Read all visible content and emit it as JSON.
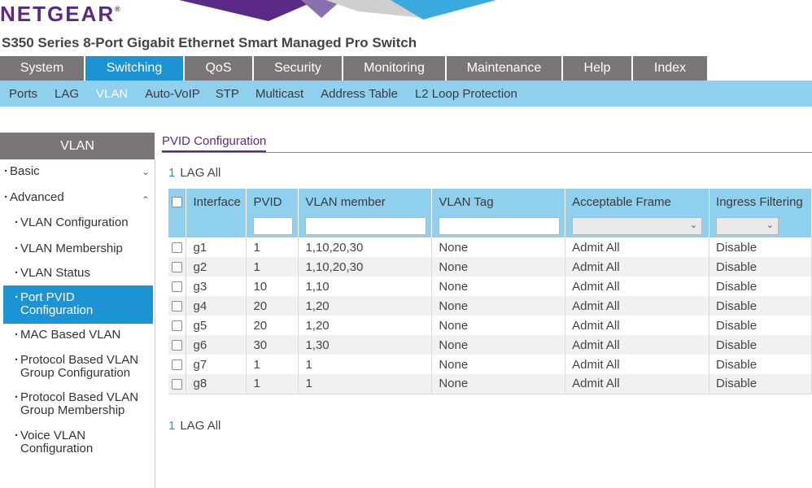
{
  "brand": {
    "logo": "NETGEAR",
    "mark": "®"
  },
  "product_title": "S350 Series 8-Port Gigabit Ethernet Smart Managed Pro Switch",
  "colors": {
    "accent": "#1c93d3",
    "brand": "#5b2a86",
    "nav_bg": "#7a7576",
    "subnav_bg": "#8fd0ee"
  },
  "main_nav": [
    {
      "label": "System"
    },
    {
      "label": "Switching"
    },
    {
      "label": "QoS"
    },
    {
      "label": "Security"
    },
    {
      "label": "Monitoring"
    },
    {
      "label": "Maintenance"
    },
    {
      "label": "Help"
    },
    {
      "label": "Index"
    }
  ],
  "sub_nav": [
    {
      "label": "Ports"
    },
    {
      "label": "LAG"
    },
    {
      "label": "VLAN"
    },
    {
      "label": "Auto-VoIP"
    },
    {
      "label": "STP"
    },
    {
      "label": "Multicast"
    },
    {
      "label": "Address Table"
    },
    {
      "label": "L2 Loop Protection"
    }
  ],
  "sidebar": {
    "title": "VLAN",
    "basic": "Basic",
    "advanced": "Advanced",
    "items": [
      {
        "line1": "VLAN Configuration",
        "line2": ""
      },
      {
        "line1": "VLAN Membership",
        "line2": ""
      },
      {
        "line1": "VLAN Status",
        "line2": ""
      },
      {
        "line1": "Port PVID",
        "line2": "Configuration"
      },
      {
        "line1": "MAC Based VLAN",
        "line2": ""
      },
      {
        "line1": "Protocol Based VLAN",
        "line2": "Group Configuration"
      },
      {
        "line1": "Protocol Based VLAN",
        "line2": "Group Membership"
      },
      {
        "line1": "Voice VLAN",
        "line2": "Configuration"
      }
    ]
  },
  "content": {
    "tab": "PVID Configuration",
    "pager": {
      "page": "1",
      "all": "LAG All"
    },
    "columns": [
      "Interface",
      "PVID",
      "VLAN member",
      "VLAN Tag",
      "Acceptable Frame",
      "Ingress Filtering"
    ],
    "rows": [
      {
        "interface": "g1",
        "pvid": "1",
        "member": "1,10,20,30",
        "tag": "None",
        "frame": "Admit All",
        "ingress": "Disable"
      },
      {
        "interface": "g2",
        "pvid": "1",
        "member": "1,10,20,30",
        "tag": "None",
        "frame": "Admit All",
        "ingress": "Disable"
      },
      {
        "interface": "g3",
        "pvid": "10",
        "member": "1,10",
        "tag": "None",
        "frame": "Admit All",
        "ingress": "Disable"
      },
      {
        "interface": "g4",
        "pvid": "20",
        "member": "1,20",
        "tag": "None",
        "frame": "Admit All",
        "ingress": "Disable"
      },
      {
        "interface": "g5",
        "pvid": "20",
        "member": "1,20",
        "tag": "None",
        "frame": "Admit All",
        "ingress": "Disable"
      },
      {
        "interface": "g6",
        "pvid": "30",
        "member": "1,30",
        "tag": "None",
        "frame": "Admit All",
        "ingress": "Disable"
      },
      {
        "interface": "g7",
        "pvid": "1",
        "member": "1",
        "tag": "None",
        "frame": "Admit All",
        "ingress": "Disable"
      },
      {
        "interface": "g8",
        "pvid": "1",
        "member": "1",
        "tag": "None",
        "frame": "Admit All",
        "ingress": "Disable"
      }
    ]
  }
}
